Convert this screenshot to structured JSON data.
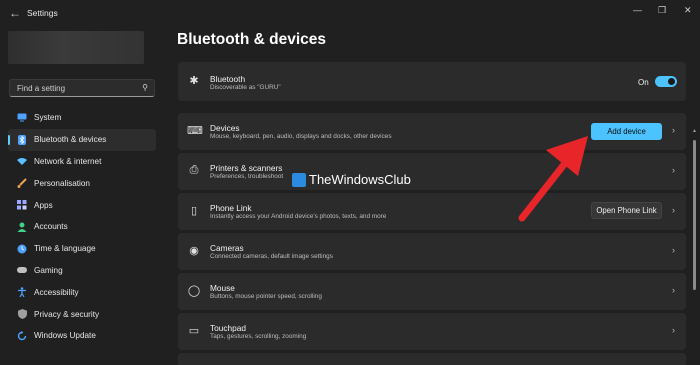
{
  "window": {
    "title": "Settings",
    "back_icon": "back-arrow-icon"
  },
  "search": {
    "placeholder": "Find a setting"
  },
  "sidebar": {
    "items": [
      {
        "label": "System",
        "icon": "monitor-icon",
        "color": "#4ea1ff"
      },
      {
        "label": "Bluetooth & devices",
        "icon": "bluetooth-icon",
        "color": "#4ea1ff",
        "active": true
      },
      {
        "label": "Network & internet",
        "icon": "wifi-icon",
        "color": "#5bc0ff"
      },
      {
        "label": "Personalisation",
        "icon": "brush-icon",
        "color": "#f0a050"
      },
      {
        "label": "Apps",
        "icon": "apps-icon",
        "color": "#9aa8ff"
      },
      {
        "label": "Accounts",
        "icon": "person-icon",
        "color": "#3fd08a"
      },
      {
        "label": "Time & language",
        "icon": "globe-clock-icon",
        "color": "#4ea1ff"
      },
      {
        "label": "Gaming",
        "icon": "controller-icon",
        "color": "#c0c0c0"
      },
      {
        "label": "Accessibility",
        "icon": "accessibility-icon",
        "color": "#4ea1ff"
      },
      {
        "label": "Privacy & security",
        "icon": "shield-icon",
        "color": "#a0a0a0"
      },
      {
        "label": "Windows Update",
        "icon": "update-icon",
        "color": "#4ea1ff"
      }
    ]
  },
  "main": {
    "title": "Bluetooth & devices",
    "cards": [
      {
        "title": "Bluetooth",
        "subtitle": "Discoverable as \"GURU\"",
        "icon": "bluetooth-icon",
        "toggle_label": "On"
      },
      {
        "title": "Devices",
        "subtitle": "Mouse, keyboard, pen, audio, displays and docks, other devices",
        "icon": "devices-icon",
        "button": "Add device"
      },
      {
        "title": "Printers & scanners",
        "subtitle": "Preferences, troubleshoot",
        "icon": "printer-icon"
      },
      {
        "title": "Phone Link",
        "subtitle": "Instantly access your Android device's photos, texts, and more",
        "icon": "phone-icon",
        "button": "Open Phone Link"
      },
      {
        "title": "Cameras",
        "subtitle": "Connected cameras, default image settings",
        "icon": "camera-icon"
      },
      {
        "title": "Mouse",
        "subtitle": "Buttons, mouse pointer speed, scrolling",
        "icon": "mouse-icon"
      },
      {
        "title": "Touchpad",
        "subtitle": "Taps, gestures, scrolling, zooming",
        "icon": "touchpad-icon"
      }
    ]
  },
  "watermark": {
    "text": "TheWindowsClub"
  },
  "colors": {
    "accent": "#4cc2ff",
    "arrow": "#e8262a",
    "background": "#202020",
    "card": "#2b2b2b"
  }
}
